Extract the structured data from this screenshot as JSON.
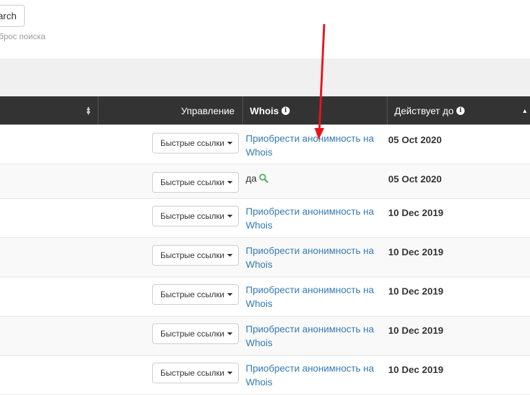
{
  "search": {
    "button_label": "Search",
    "reset_link": "Сброс поиска"
  },
  "table": {
    "headers": {
      "management": "Управление",
      "whois": "Whois",
      "expires": "Действует до"
    },
    "rows": [
      {
        "quick_links": "Быстрые ссылки",
        "whois": "Приобрести анонимность на Whois",
        "whois_type": "link",
        "expires": "05 Oct 2020"
      },
      {
        "quick_links": "Быстрые ссылки",
        "whois": "да",
        "whois_type": "yes",
        "expires": "05 Oct 2020"
      },
      {
        "quick_links": "Быстрые ссылки",
        "whois": "Приобрести анонимность на Whois",
        "whois_type": "link",
        "expires": "10 Dec 2019"
      },
      {
        "quick_links": "Быстрые ссылки",
        "whois": "Приобрести анонимность на Whois",
        "whois_type": "link",
        "expires": "10 Dec 2019"
      },
      {
        "quick_links": "Быстрые ссылки",
        "whois": "Приобрести анонимность на Whois",
        "whois_type": "link",
        "expires": "10 Dec 2019"
      },
      {
        "quick_links": "Быстрые ссылки",
        "whois": "Приобрести анонимность на Whois",
        "whois_type": "link",
        "expires": "10 Dec 2019"
      },
      {
        "quick_links": "Быстрые ссылки",
        "whois": "Приобрести анонимность на Whois",
        "whois_type": "link",
        "expires": "10 Dec 2019"
      }
    ]
  },
  "colors": {
    "header_bg": "#333333",
    "link": "#337ab7",
    "annotation_arrow": "#e8141c",
    "search_icon": "#5cb85c"
  }
}
